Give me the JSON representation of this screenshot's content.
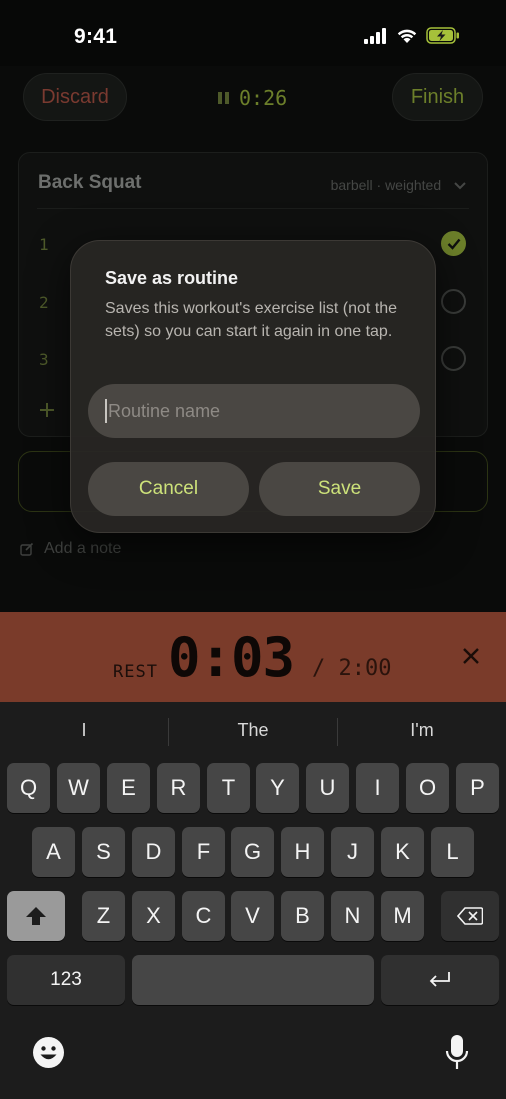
{
  "status": {
    "time": "9:41"
  },
  "header": {
    "discard_label": "Discard",
    "finish_label": "Finish",
    "elapsed": "0:26"
  },
  "exercise": {
    "title": "Back Squat",
    "tags": "barbell · weighted",
    "sets": [
      {
        "num": "1",
        "done": true
      },
      {
        "num": "2",
        "done": false
      },
      {
        "num": "3",
        "done": false
      }
    ]
  },
  "note": {
    "label": "Add a note"
  },
  "dialog": {
    "title": "Save as routine",
    "message": "Saves this workout's exercise list (not the sets) so you can start it again in one tap.",
    "placeholder": "Routine name",
    "cancel_label": "Cancel",
    "save_label": "Save"
  },
  "rest": {
    "label": "REST",
    "remaining": "0:03",
    "total": "/ 2:00"
  },
  "keyboard": {
    "suggestions": [
      "I",
      "The",
      "I'm"
    ],
    "row1": [
      "Q",
      "W",
      "E",
      "R",
      "T",
      "Y",
      "U",
      "I",
      "O",
      "P"
    ],
    "row2": [
      "A",
      "S",
      "D",
      "F",
      "G",
      "H",
      "J",
      "K",
      "L"
    ],
    "row3": [
      "Z",
      "X",
      "C",
      "V",
      "B",
      "N",
      "M"
    ],
    "numbers_label": "123"
  },
  "colors": {
    "accent": "#cde27a",
    "rest_banner": "#7a3b2a",
    "dialog_bg": "#2a2826"
  }
}
